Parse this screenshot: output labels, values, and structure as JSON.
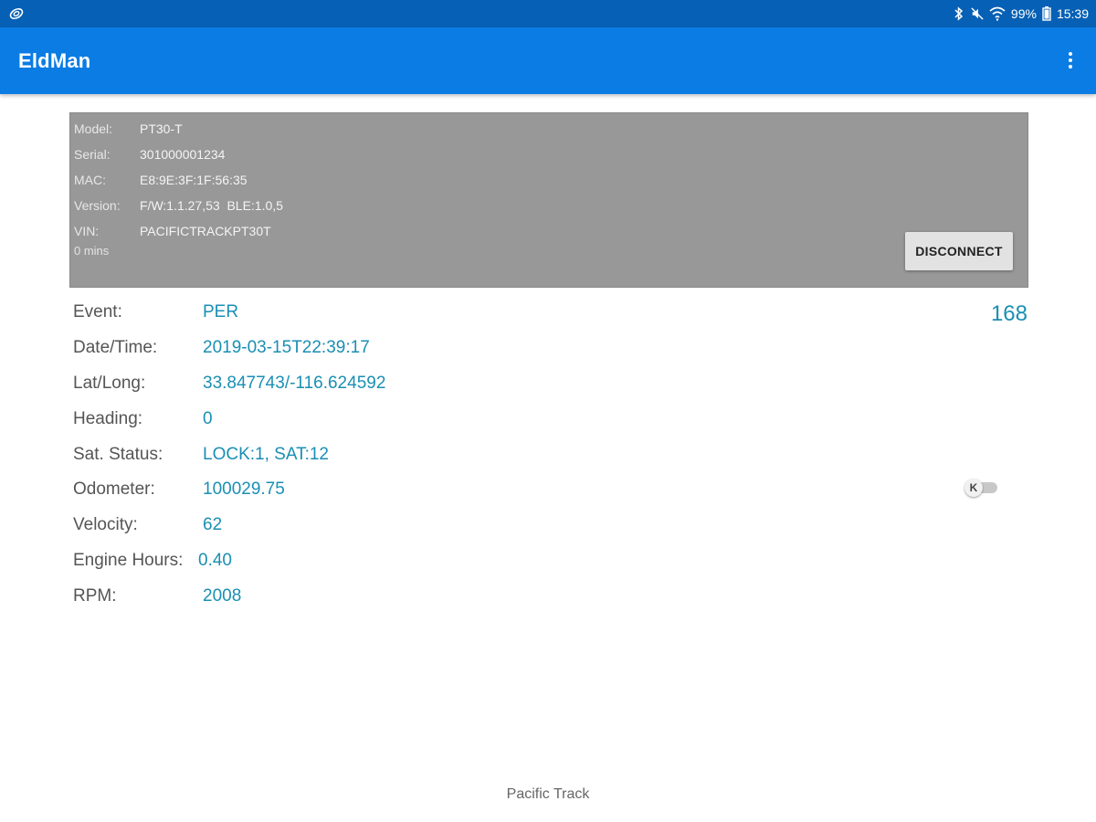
{
  "status_bar": {
    "left_icon": "link-icon",
    "icons": [
      "bluetooth-icon",
      "mute-icon",
      "wifi-icon"
    ],
    "battery": "99%",
    "battery_icon": "battery-icon",
    "time": "15:39"
  },
  "app_bar": {
    "title": "EldMan",
    "menu_icon": "overflow-menu-icon"
  },
  "device": {
    "rows": [
      {
        "label": "Model:",
        "value": "PT30-T"
      },
      {
        "label": "Serial:",
        "value": "301000001234"
      },
      {
        "label": "MAC:",
        "value": "E8:9E:3F:1F:56:35"
      },
      {
        "label": "Version:",
        "value": "F/W:1.1.27,53  BLE:1.0,5"
      },
      {
        "label": "VIN:",
        "value": "PACIFICTRACKPT30T"
      }
    ],
    "duration": "0 mins",
    "disconnect_label": "DISCONNECT"
  },
  "counter": "168",
  "data": [
    {
      "label": "Event:",
      "value": "PER"
    },
    {
      "label": "Date/Time:",
      "value": "2019-03-15T22:39:17"
    },
    {
      "label": "Lat/Long:",
      "value": "33.847743/-116.624592"
    },
    {
      "label": "Heading:",
      "value": "0"
    },
    {
      "label": "Sat. Status:",
      "value": "LOCK:1, SAT:12"
    },
    {
      "label": "Odometer:",
      "value": "100029.75"
    },
    {
      "label": "Velocity:",
      "value": "62"
    },
    {
      "label": "Engine Hours:",
      "value": "0.40"
    },
    {
      "label": "RPM:",
      "value": "2008"
    }
  ],
  "unit_toggle": {
    "thumb_label": "K",
    "on": false
  },
  "footer": "Pacific Track",
  "colors": {
    "status_bar": "#0660b5",
    "app_bar": "#0b7ce4",
    "panel": "#989898",
    "value_text": "#1a8fb3",
    "label_text": "#555555"
  }
}
